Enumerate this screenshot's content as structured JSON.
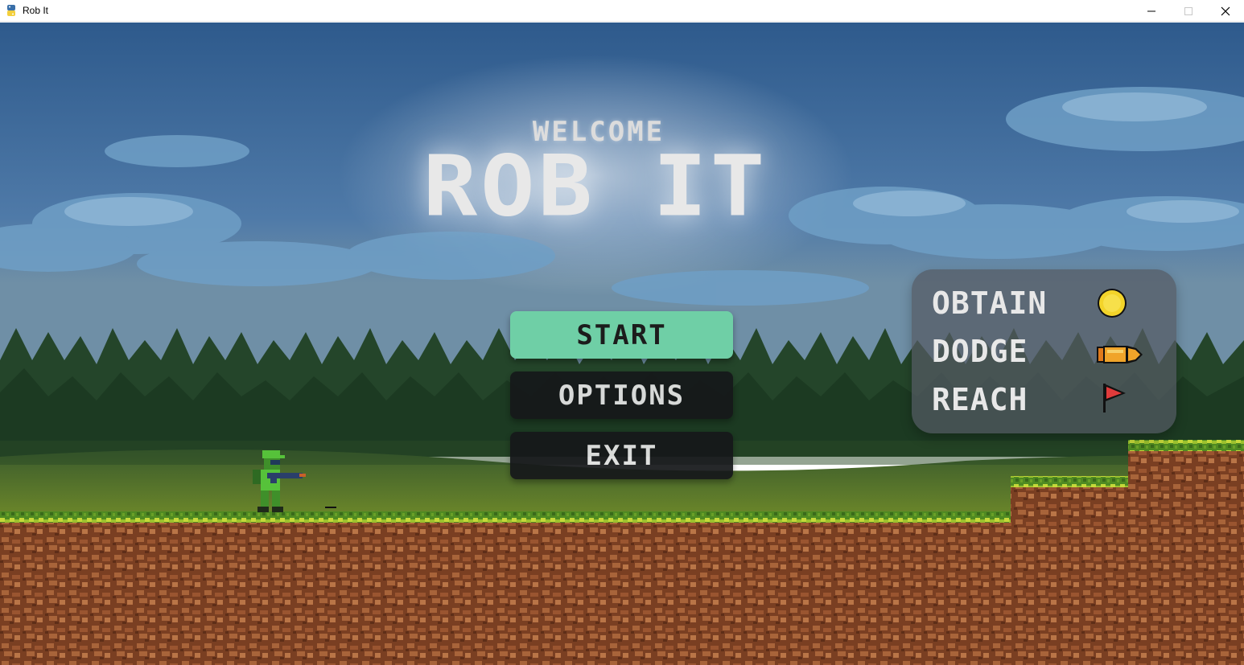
{
  "window": {
    "title": "Rob It",
    "icon": "python-icon",
    "controls": [
      "minimize-icon",
      "maximize-icon",
      "close-icon"
    ]
  },
  "screen": {
    "welcome": "WELCOME",
    "title": "ROB IT"
  },
  "menu": {
    "start": "START",
    "options": "OPTIONS",
    "exit": "EXIT",
    "selected": "START"
  },
  "instructions": [
    {
      "label": "OBTAIN",
      "icon": "coin-icon"
    },
    {
      "label": "DODGE",
      "icon": "bullet-icon"
    },
    {
      "label": "REACH",
      "icon": "flag-icon"
    }
  ],
  "colors": {
    "start_button": "#6fcfa6",
    "dark_button": "#16181a",
    "sky": "#3d6a9c",
    "grass": "#7fbf2a",
    "dirt": "#8a4b27"
  }
}
